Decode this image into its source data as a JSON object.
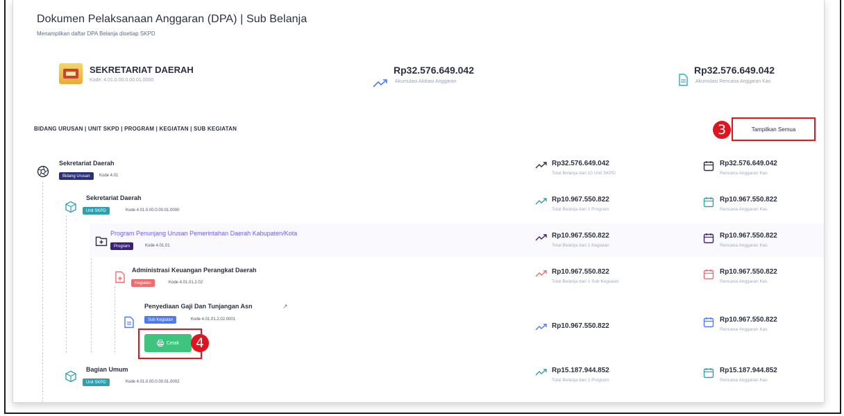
{
  "header": {
    "title": "Dokumen Pelaksanaan Anggaran (DPA) | Sub Belanja",
    "subtitle": "Menampilkan daftar DPA Belanja disetiap SKPD"
  },
  "summary": {
    "unit_name": "SEKRETARIAT DAERAH",
    "unit_code": "Kode: 4.01.0.00.0.00.01.0000",
    "allocation_value": "Rp32.576.649.042",
    "allocation_label": "Akumulasi Alokasi Anggaran",
    "cash_value": "Rp32.576.649.042",
    "cash_label": "Akumulasi Rencana Anggaran Kas"
  },
  "breadcrumb": "BIDANG URUSAN | UNIT SKPD | PROGRAM | KEGIATAN | SUB KEGIATAN",
  "show_all_label": "Tampilkan Semua",
  "step_badges": {
    "show_all": "3",
    "print": "4"
  },
  "colors": {
    "accent_red": "#e0141e",
    "tag_bidang": "#2b2f78",
    "tag_unit": "#2f9fb0",
    "tag_program": "#3b1f7a",
    "tag_kegiatan": "#f06b6b",
    "tag_sub": "#4f7bf0",
    "print_button": "#3fc47d"
  },
  "tree": [
    {
      "icon": "aperture-icon",
      "title": "Sekretariat Daerah",
      "tag": "Bidang Urusan",
      "code": "Kode 4.01",
      "amount": "Rp32.576.649.042",
      "amount_label": "Total Belanja dari 10 Unit SKPD",
      "cash": "Rp32.576.649.042",
      "cash_label": "Rencana Anggaran Kas"
    },
    {
      "icon": "cube-icon",
      "title": "Sekretariat Daerah",
      "tag": "Unit SKPD",
      "code": "Kode 4.01.0.00.0.00.01.0000",
      "amount": "Rp10.967.550.822",
      "amount_label": "Total Belanja dari 1 Program",
      "cash": "Rp10.967.550.822",
      "cash_label": "Rencana Anggaran Kas"
    },
    {
      "icon": "folder-plus-icon",
      "title": "Program Penunjang Urusan Pemerintahan Daerah Kabupaten/Kota",
      "tag": "Program",
      "code": "Kode 4.01.01",
      "amount": "Rp10.967.550.822",
      "amount_label": "Total Belanja dari 1 Kegiatan",
      "cash": "Rp10.967.550.822",
      "cash_label": "Rencana Anggaran Kas"
    },
    {
      "icon": "file-plus-icon",
      "title": "Administrasi Keuangan Perangkat Daerah",
      "tag": "Kegiatan",
      "code": "Kode 4.01.01.2.02",
      "amount": "Rp10.967.550.822",
      "amount_label": "Total Belanja dari 1 Sub Kegiatan",
      "cash": "Rp10.967.550.822",
      "cash_label": "Rencana Anggaran Kas"
    },
    {
      "icon": "document-icon",
      "title": "Penyediaan Gaji Dan Tunjangan Asn",
      "tag": "Sub Kegiatan",
      "code": "Kode 4.01.01.2.02.0001",
      "print_label": "Cetak",
      "amount": "Rp10.967.550.822",
      "cash": "Rp10.967.550.822",
      "cash_label": "Rencana Anggaran Kas"
    },
    {
      "icon": "cube-icon",
      "title": "Bagian Umum",
      "tag": "Unit SKPD",
      "code": "Kode 4.01.0.00.0.00.01.0002",
      "amount": "Rp15.187.944.852",
      "amount_label": "Total Belanja dari 1 Program",
      "cash": "Rp15.187.944.852",
      "cash_label": "Rencana Anggaran Kas"
    }
  ]
}
